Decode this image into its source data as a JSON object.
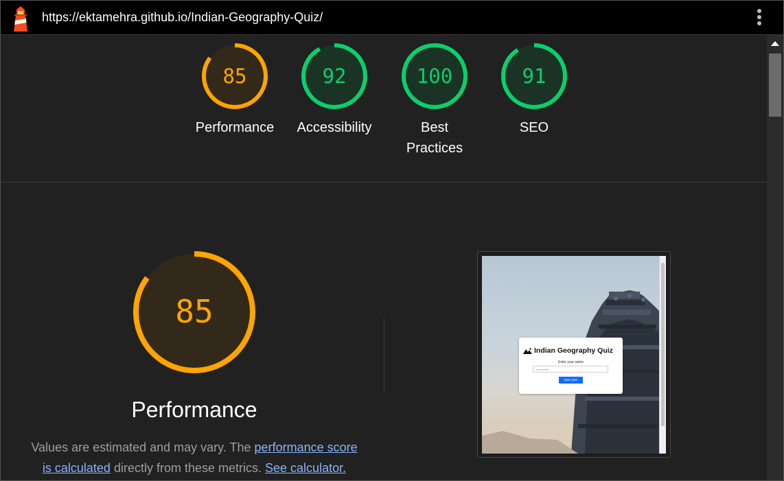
{
  "browser": {
    "url": "https://ektamehra.github.io/Indian-Geography-Quiz/",
    "brand_color": "#f44b21"
  },
  "categories": [
    {
      "id": "performance",
      "score": "85",
      "label": "Performance",
      "color": "#ffa400",
      "fill": "#33291a"
    },
    {
      "id": "accessibility",
      "score": "92",
      "label": "Accessibility",
      "color": "#0cce6b",
      "fill": "#1b3324"
    },
    {
      "id": "best-practices",
      "score": "100",
      "label": "Best Practices",
      "color": "#0cce6b",
      "fill": "#1b3324"
    },
    {
      "id": "seo",
      "score": "91",
      "label": "SEO",
      "color": "#0cce6b",
      "fill": "#1b3324"
    }
  ],
  "performance_section": {
    "score": "85",
    "title": "Performance",
    "desc_prefix": "Values are estimated and may vary. The ",
    "link_score": "performance score is calculated",
    "desc_middle": " directly from these metrics. ",
    "link_calculator": "See calculator."
  },
  "screenshot": {
    "title": "Indian Geography Quiz",
    "label": "Enter your name",
    "placeholder": "Your name",
    "button": "Start Quiz",
    "button_color": "#0d6efd"
  }
}
